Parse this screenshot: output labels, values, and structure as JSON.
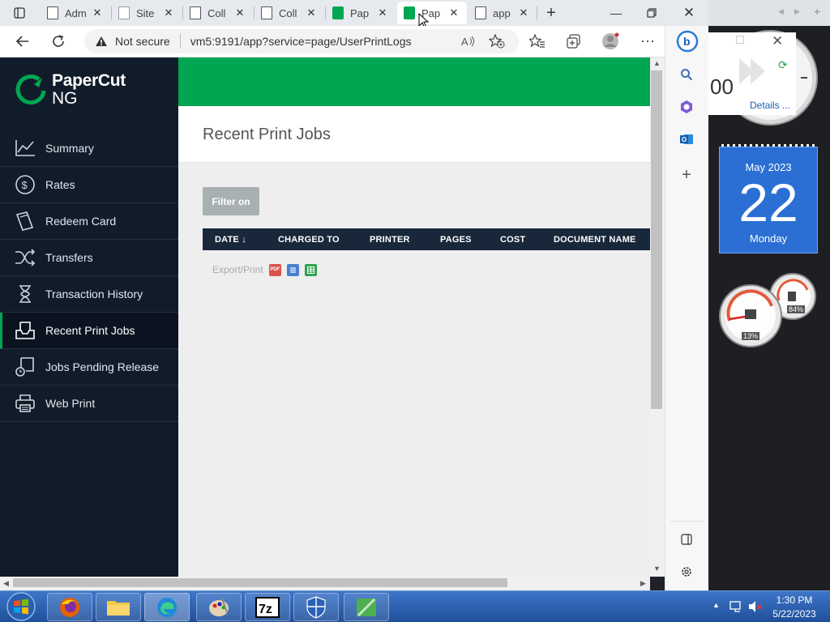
{
  "browser": {
    "tabs": [
      {
        "title": "Adm",
        "icon": "page-icon"
      },
      {
        "title": "Site",
        "icon": "page-icon"
      },
      {
        "title": "Coll",
        "icon": "page-icon"
      },
      {
        "title": "Coll",
        "icon": "page-icon"
      },
      {
        "title": "Pap",
        "icon": "papercut-icon"
      },
      {
        "title": "Pap",
        "icon": "papercut-icon",
        "active": true
      },
      {
        "title": "app",
        "icon": "page-icon"
      }
    ],
    "security_label": "Not secure",
    "url": "vm5:9191/app?service=page/UserPrintLogs"
  },
  "app": {
    "logo_text": "PaperCut",
    "logo_sub": "NG",
    "brand_color": "#00a651",
    "nav": [
      {
        "label": "Summary",
        "icon": "chart-line-icon"
      },
      {
        "label": "Rates",
        "icon": "dollar-icon"
      },
      {
        "label": "Redeem Card",
        "icon": "card-icon"
      },
      {
        "label": "Transfers",
        "icon": "shuffle-icon"
      },
      {
        "label": "Transaction History",
        "icon": "hourglass-icon"
      },
      {
        "label": "Recent Print Jobs",
        "icon": "inbox-tray-icon",
        "active": true
      },
      {
        "label": "Jobs Pending Release",
        "icon": "pending-release-icon"
      },
      {
        "label": "Web Print",
        "icon": "printer-icon"
      }
    ],
    "page_title": "Recent Print Jobs",
    "filter_label": "Filter on",
    "table": {
      "columns": [
        "DATE",
        "CHARGED TO",
        "PRINTER",
        "PAGES",
        "COST",
        "DOCUMENT NAME"
      ],
      "sort_indicator": "↓",
      "rows": []
    },
    "export_label": "Export/Print",
    "export_formats": [
      "PDF",
      "HTML",
      "CSV"
    ]
  },
  "gadgets": {
    "clock_partial": "00",
    "details_link": "Details ...",
    "calendar": {
      "month_year": "May 2023",
      "day": "22",
      "weekday": "Monday"
    },
    "meter_cpu": "13%",
    "meter_mem": "84%"
  },
  "taskbar": {
    "time": "1:30 PM",
    "date": "5/22/2023"
  }
}
